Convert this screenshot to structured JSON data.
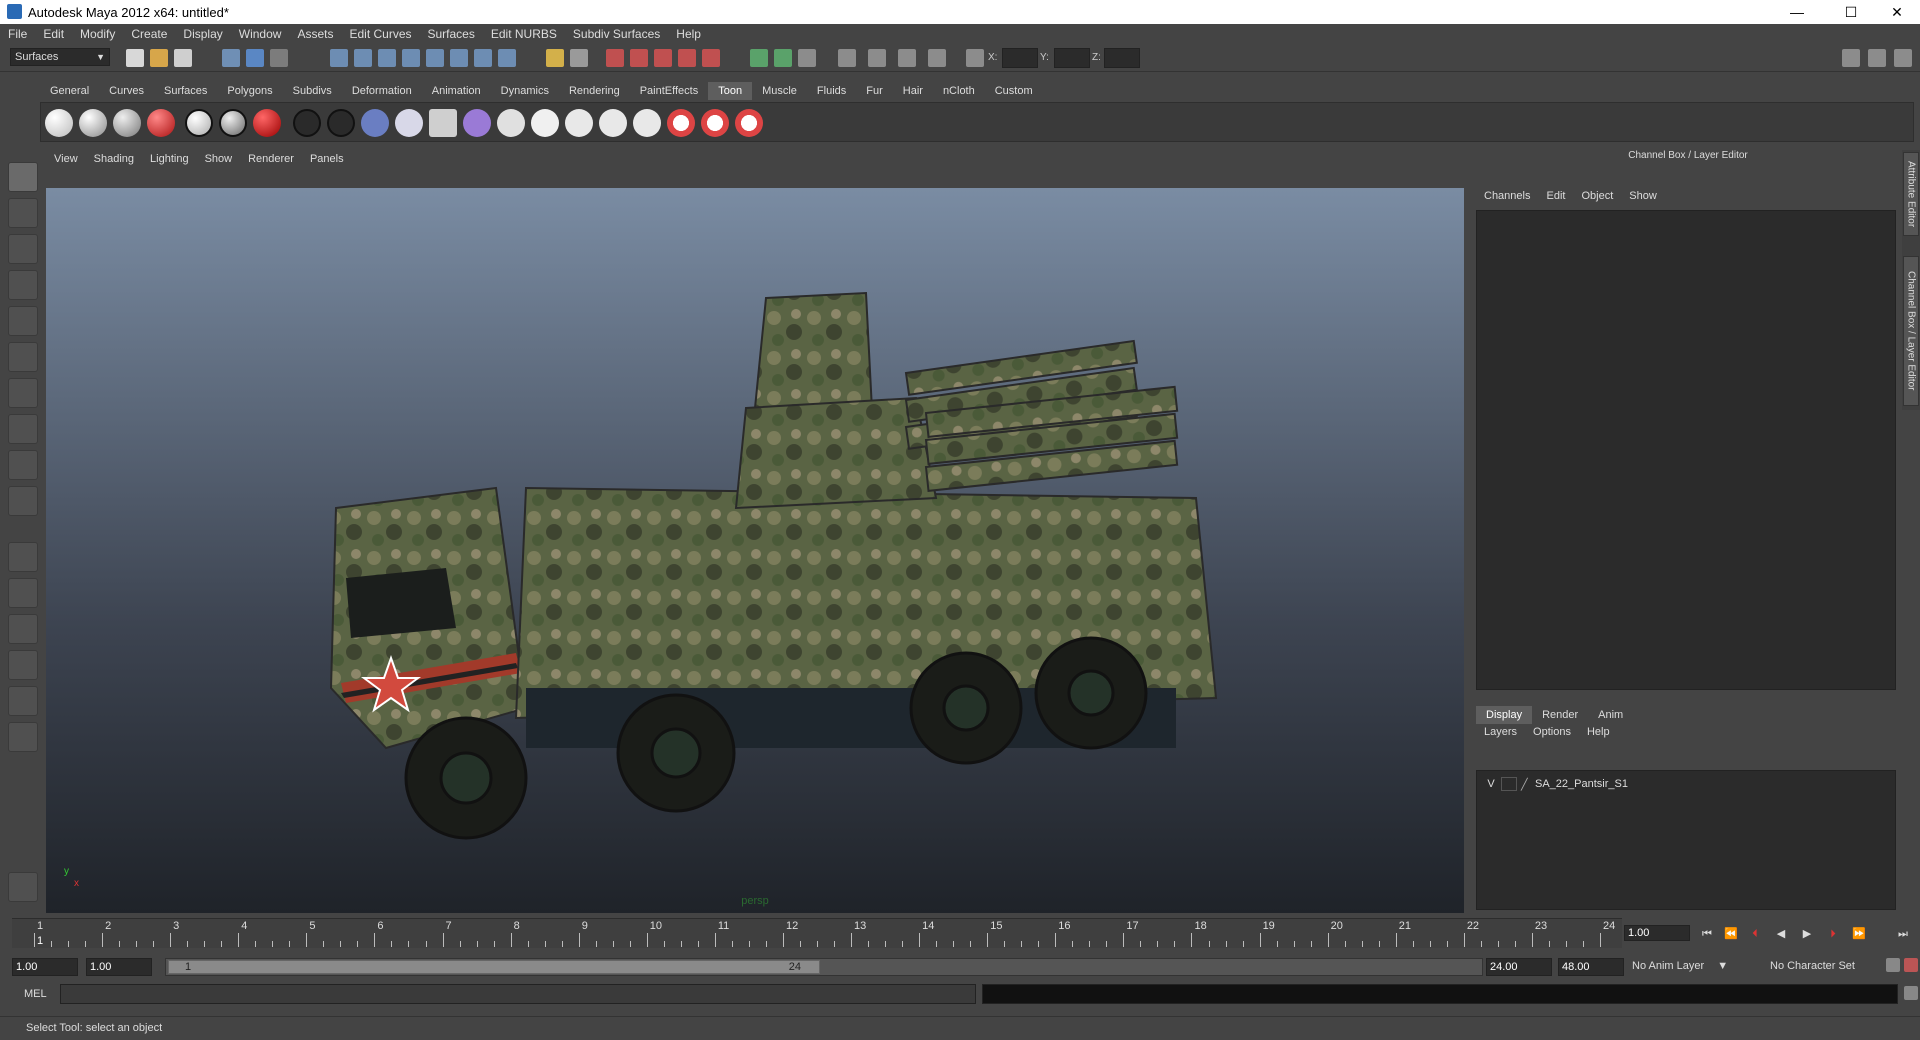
{
  "window": {
    "title": "Autodesk Maya 2012 x64: untitled*",
    "minimize": "—",
    "maximize": "☐",
    "close": "✕"
  },
  "menubar": {
    "items": [
      "File",
      "Edit",
      "Modify",
      "Create",
      "Display",
      "Window",
      "Assets",
      "Edit Curves",
      "Surfaces",
      "Edit NURBS",
      "Subdiv Surfaces",
      "Help"
    ]
  },
  "statusline": {
    "mode": "Surfaces",
    "x_label": "X:",
    "y_label": "Y:",
    "z_label": "Z:"
  },
  "shelf": {
    "tabs": [
      "General",
      "Curves",
      "Surfaces",
      "Polygons",
      "Subdivs",
      "Deformation",
      "Animation",
      "Dynamics",
      "Rendering",
      "PaintEffects",
      "Toon",
      "Muscle",
      "Fluids",
      "Fur",
      "Hair",
      "nCloth",
      "Custom"
    ],
    "active_tab": "Toon"
  },
  "viewport": {
    "menu": [
      "View",
      "Shading",
      "Lighting",
      "Show",
      "Renderer",
      "Panels"
    ],
    "camera_label": "persp",
    "axis_x": "x",
    "axis_y": "y"
  },
  "channel_box": {
    "title": "Channel Box / Layer Editor",
    "menu": [
      "Channels",
      "Edit",
      "Object",
      "Show"
    ]
  },
  "layer_editor": {
    "tabs": [
      "Display",
      "Render",
      "Anim"
    ],
    "active_tab": "Display",
    "menu": [
      "Layers",
      "Options",
      "Help"
    ],
    "layers": [
      {
        "visible": "V",
        "name": "SA_22_Pantsir_S1"
      }
    ]
  },
  "side_tabs": {
    "attribute_editor": "Attribute Editor",
    "channel_box": "Channel Box / Layer Editor"
  },
  "timeline": {
    "ticks": [
      "1",
      "2",
      "3",
      "4",
      "5",
      "6",
      "7",
      "8",
      "9",
      "10",
      "11",
      "12",
      "13",
      "14",
      "15",
      "16",
      "17",
      "18",
      "19",
      "20",
      "21",
      "22",
      "23",
      "24"
    ],
    "current_marker": "1",
    "current_frame": "1.00"
  },
  "range": {
    "start": "1.00",
    "playback_start": "1.00",
    "range_start_label": "1",
    "range_end_label": "24",
    "playback_end": "24.00",
    "end": "48.00",
    "anim_layer": "No Anim Layer",
    "character_set": "No Character Set"
  },
  "cmdline": {
    "label": "MEL"
  },
  "helpline": {
    "text": "Select Tool: select an object"
  }
}
